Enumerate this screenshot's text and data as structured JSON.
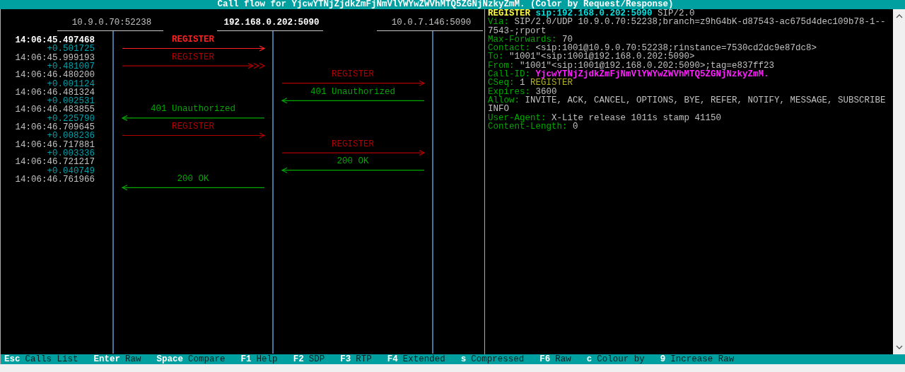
{
  "title": "Call flow for YjcwYTNjZjdkZmFjNmVlYWYwZWVhMTQ5ZGNjNzkyZmM. (Color by Request/Response)",
  "hosts": [
    {
      "address": "10.9.0.70:52238",
      "selected": false
    },
    {
      "address": "192.168.0.202:5090",
      "selected": true
    },
    {
      "address": "10.0.7.146:5090",
      "selected": false
    }
  ],
  "messages": [
    {
      "time": "14:06:45.497468",
      "delta": "+0.501725",
      "label": "REGISTER",
      "kind": "request",
      "right_pair": false,
      "rightward": true,
      "retransmission": false,
      "selected": true
    },
    {
      "time": "14:06:45.999193",
      "delta": "+0.481007",
      "label": "REGISTER",
      "kind": "request",
      "right_pair": false,
      "rightward": true,
      "retransmission": true,
      "selected": false
    },
    {
      "time": "14:06:46.480200",
      "delta": "+0.001124",
      "label": "REGISTER",
      "kind": "request",
      "right_pair": true,
      "rightward": true,
      "retransmission": false,
      "selected": false
    },
    {
      "time": "14:06:46.481324",
      "delta": "+0.002531",
      "label": "401 Unauthorized",
      "kind": "response",
      "right_pair": true,
      "rightward": false,
      "retransmission": false,
      "selected": false
    },
    {
      "time": "14:06:46.483855",
      "delta": "+0.225790",
      "label": "401 Unauthorized",
      "kind": "response",
      "right_pair": false,
      "rightward": false,
      "retransmission": false,
      "selected": false
    },
    {
      "time": "14:06:46.709645",
      "delta": "+0.008236",
      "label": "REGISTER",
      "kind": "request",
      "right_pair": false,
      "rightward": true,
      "retransmission": false,
      "selected": false
    },
    {
      "time": "14:06:46.717881",
      "delta": "+0.003336",
      "label": "REGISTER",
      "kind": "request",
      "right_pair": true,
      "rightward": true,
      "retransmission": false,
      "selected": false
    },
    {
      "time": "14:06:46.721217",
      "delta": "+0.040749",
      "label": "200 OK",
      "kind": "response",
      "right_pair": true,
      "rightward": false,
      "retransmission": false,
      "selected": false
    },
    {
      "time": "14:06:46.761966",
      "label": "200 OK",
      "kind": "response",
      "right_pair": false,
      "rightward": false,
      "retransmission": false,
      "selected": false
    }
  ],
  "message_lines": [
    {
      "parts": [
        {
          "text": "REGISTER",
          "kind": "method"
        },
        {
          "text": "sip:192.168.0.202:5090",
          "kind": "uri"
        },
        {
          "text": "SIP/2.0",
          "kind": "value"
        }
      ]
    },
    {
      "parts": [
        {
          "text": "Via:",
          "kind": "header"
        },
        {
          "text": "SIP/2.0/UDP 10.9.0.70:52238;branch=z9hG4bK-d87543-ac675d4dec109b78-1--",
          "kind": "value"
        }
      ]
    },
    {
      "parts": [
        {
          "text": "7543-;rport",
          "kind": "value"
        }
      ]
    },
    {
      "parts": [
        {
          "text": "Max-Forwards:",
          "kind": "header"
        },
        {
          "text": "70",
          "kind": "value"
        }
      ]
    },
    {
      "parts": [
        {
          "text": "Contact:",
          "kind": "header"
        },
        {
          "text": "<sip:1001@10.9.0.70:52238;rinstance=7530cd2dc9e87dc8>",
          "kind": "value"
        }
      ]
    },
    {
      "parts": [
        {
          "text": "To:",
          "kind": "header"
        },
        {
          "text": "\"1001\"<sip:1001@192.168.0.202:5090>",
          "kind": "value"
        }
      ]
    },
    {
      "parts": [
        {
          "text": "From:",
          "kind": "header"
        },
        {
          "text": "\"1001\"<sip:1001@192.168.0.202:5090>;tag=e837ff23",
          "kind": "value"
        }
      ]
    },
    {
      "parts": [
        {
          "text": "Call-ID:",
          "kind": "header"
        },
        {
          "text": "YjcwYTNjZjdkZmFjNmVlYWYwZWVhMTQ5ZGNjNzkyZmM.",
          "kind": "callid"
        }
      ]
    },
    {
      "parts": [
        {
          "text": "CSeq:",
          "kind": "header"
        },
        {
          "text": "1",
          "kind": "value"
        },
        {
          "text": "REGISTER",
          "kind": "cseq-method"
        }
      ]
    },
    {
      "parts": [
        {
          "text": "Expires:",
          "kind": "header"
        },
        {
          "text": "3600",
          "kind": "value"
        }
      ]
    },
    {
      "parts": [
        {
          "text": "Allow:",
          "kind": "header"
        },
        {
          "text": "INVITE, ACK, CANCEL, OPTIONS, BYE, REFER, NOTIFY, MESSAGE, SUBSCRIBE",
          "kind": "value"
        }
      ]
    },
    {
      "parts": [
        {
          "text": "INFO",
          "kind": "value"
        }
      ]
    },
    {
      "parts": [
        {
          "text": "User-Agent:",
          "kind": "header"
        },
        {
          "text": "X-Lite release 1011s stamp 41150",
          "kind": "value"
        }
      ]
    },
    {
      "parts": [
        {
          "text": "Content-Length:",
          "kind": "header"
        },
        {
          "text": "0",
          "kind": "value"
        }
      ]
    }
  ],
  "shortcuts": [
    {
      "key": "Esc",
      "action": "Calls List"
    },
    {
      "key": "Enter",
      "action": "Raw"
    },
    {
      "key": "Space",
      "action": "Compare"
    },
    {
      "key": "F1",
      "action": "Help"
    },
    {
      "key": "F2",
      "action": "SDP"
    },
    {
      "key": "F3",
      "action": "RTP"
    },
    {
      "key": "F4",
      "action": "Extended"
    },
    {
      "key": "s",
      "action": "Compressed"
    },
    {
      "key": "F6",
      "action": "Raw"
    },
    {
      "key": "c",
      "action": "Colour by"
    },
    {
      "key": "9",
      "action": "Increase Raw"
    }
  ]
}
